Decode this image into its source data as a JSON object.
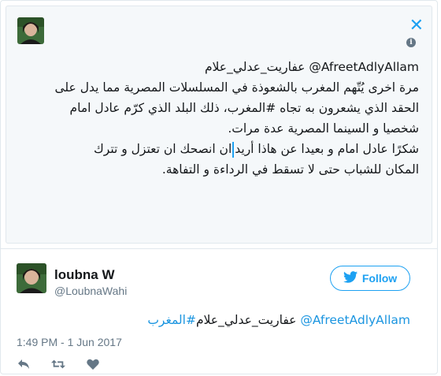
{
  "quoted_tweet": {
    "line1_mention": "@AfreetAdlyAllam",
    "line1_name": "عفاريت_عدلي_علام",
    "lines": [
      "مرة اخرى يُتّهم المغرب بالشعوذة في المسلسلات المصرية مما يدل على",
      "الحقد الذي يشعرون به تجاه #المغرب، ذلك البلد الذي كرّم عادل امام",
      "شخصيا و السينما المصرية عدة مرات."
    ],
    "line5_part1": "شكرًا عادل امام و بعيدا عن هاذا أريد",
    "line5_part2": "ان انصحك ان تعتزل و تترك",
    "line6": "المكان للشباب حتى لا تسقط في الرداءة و التفاهة."
  },
  "author": {
    "name": "loubna W",
    "handle": "@LoubnaWahi"
  },
  "follow_label": "Follow",
  "tweet": {
    "mention": "@AfreetAdlyAllam",
    "name_tag": "عفاريت_عدلي_علام",
    "hashtag": "#المغرب"
  },
  "timestamp": "1:49 PM - 1 Jun 2017",
  "colors": {
    "accent": "#1da1f2",
    "muted": "#657786"
  },
  "icons": [
    "close-icon",
    "info-icon",
    "twitter-bird-icon",
    "reply-icon",
    "retweet-icon",
    "like-icon"
  ]
}
